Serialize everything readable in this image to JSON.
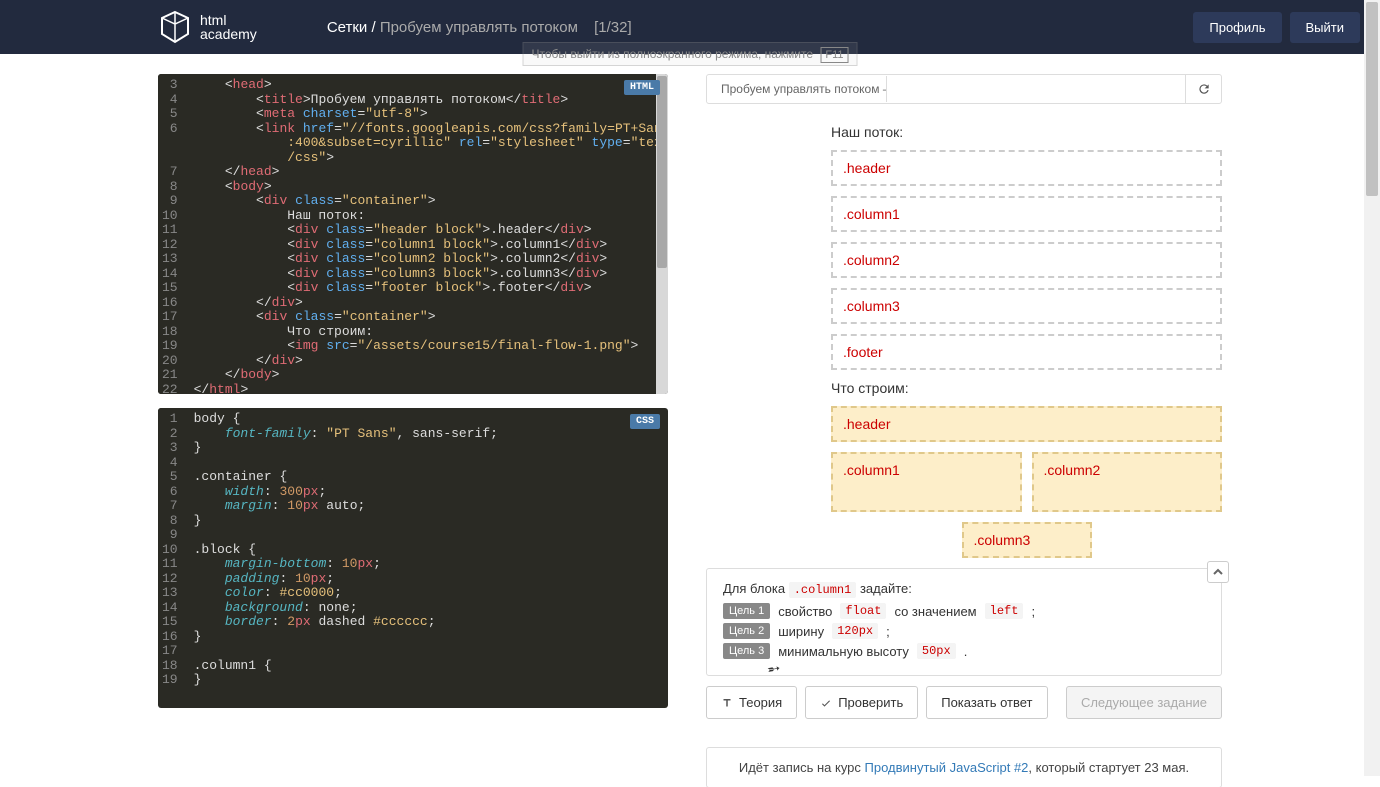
{
  "header": {
    "logo_top": "html",
    "logo_bottom": "academy",
    "breadcrumb_main": "Сетки /",
    "breadcrumb_sub": "Пробуем управлять потоком",
    "breadcrumb_count": "[1/32]",
    "exit_hint": "Чтобы выйти из полноэкранного режима, нажмите",
    "exit_key": "F11",
    "profile_btn": "Профиль",
    "logout_btn": "Выйти"
  },
  "editor_html": {
    "badge": "HTML",
    "lines": [
      "3",
      "4",
      "5",
      "6",
      "",
      "",
      "7",
      "8",
      "9",
      "10",
      "11",
      "12",
      "13",
      "14",
      "15",
      "16",
      "17",
      "18",
      "19",
      "20",
      "21",
      "22"
    ]
  },
  "editor_css": {
    "badge": "CSS",
    "lines": [
      "1",
      "2",
      "3",
      "4",
      "5",
      "6",
      "7",
      "8",
      "9",
      "10",
      "11",
      "12",
      "13",
      "14",
      "15",
      "16",
      "17",
      "18",
      "19"
    ]
  },
  "preview": {
    "tab_title": "Пробуем управлять потоком — H",
    "section1_title": "Наш поток:",
    "boxes1": [
      ".header",
      ".column1",
      ".column2",
      ".column3",
      ".footer"
    ],
    "section2_title": "Что строим:",
    "box_header": ".header",
    "box_col1": ".column1",
    "box_col2": ".column2",
    "box_col3": ".column3"
  },
  "goals": {
    "intro_pre": "Для блока",
    "intro_code": ".column1",
    "intro_post": "задайте:",
    "rows": [
      {
        "badge": "Цель 1",
        "pre": "свойство",
        "code1": "float",
        "mid": "со значением",
        "code2": "left",
        "post": ";"
      },
      {
        "badge": "Цель 2",
        "pre": "ширину",
        "code1": "120px",
        "mid": ";",
        "code2": "",
        "post": ""
      },
      {
        "badge": "Цель 3",
        "pre": "минимальную высоту",
        "code1": "50px",
        "mid": ".",
        "code2": "",
        "post": ""
      }
    ]
  },
  "actions": {
    "theory": "Теория",
    "check": "Проверить",
    "show_answer": "Показать ответ",
    "next": "Следующее задание"
  },
  "footer": {
    "pre": "Идёт запись на курс ",
    "link": "Продвинутый JavaScript #2",
    "post": ", который стартует 23 мая."
  }
}
